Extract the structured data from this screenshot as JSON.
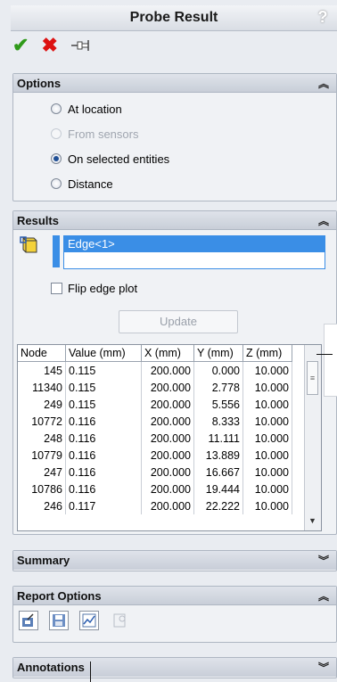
{
  "window": {
    "title": "Probe Result",
    "help_glyph": "?"
  },
  "actions": {
    "ok_glyph": "✔",
    "cancel_glyph": "✖"
  },
  "options": {
    "title": "Options",
    "items": [
      {
        "label": "At location",
        "selected": false,
        "enabled": true
      },
      {
        "label": "From sensors",
        "selected": false,
        "enabled": false
      },
      {
        "label": "On selected entities",
        "selected": true,
        "enabled": true
      },
      {
        "label": "Distance",
        "selected": false,
        "enabled": true
      }
    ]
  },
  "results": {
    "title": "Results",
    "selection": "Edge<1>",
    "flip_label": "Flip edge plot",
    "update_label": "Update",
    "columns": [
      "Node",
      "Value (mm)",
      "X (mm)",
      "Y (mm)",
      "Z (mm)"
    ],
    "rows": [
      [
        "145",
        "0.115",
        "200.000",
        "0.000",
        "10.000"
      ],
      [
        "11340",
        "0.115",
        "200.000",
        "2.778",
        "10.000"
      ],
      [
        "249",
        "0.115",
        "200.000",
        "5.556",
        "10.000"
      ],
      [
        "10772",
        "0.116",
        "200.000",
        "8.333",
        "10.000"
      ],
      [
        "248",
        "0.116",
        "200.000",
        "11.111",
        "10.000"
      ],
      [
        "10779",
        "0.116",
        "200.000",
        "13.889",
        "10.000"
      ],
      [
        "247",
        "0.116",
        "200.000",
        "16.667",
        "10.000"
      ],
      [
        "10786",
        "0.116",
        "200.000",
        "19.444",
        "10.000"
      ],
      [
        "246",
        "0.117",
        "200.000",
        "22.222",
        "10.000"
      ]
    ]
  },
  "summary": {
    "title": "Summary"
  },
  "report_options": {
    "title": "Report Options"
  },
  "annotations": {
    "title": "Annotations"
  },
  "colors": {
    "selection_blue": "#3a8ee6",
    "ok_green": "#2f9a1a",
    "cancel_red": "#dd1111"
  }
}
